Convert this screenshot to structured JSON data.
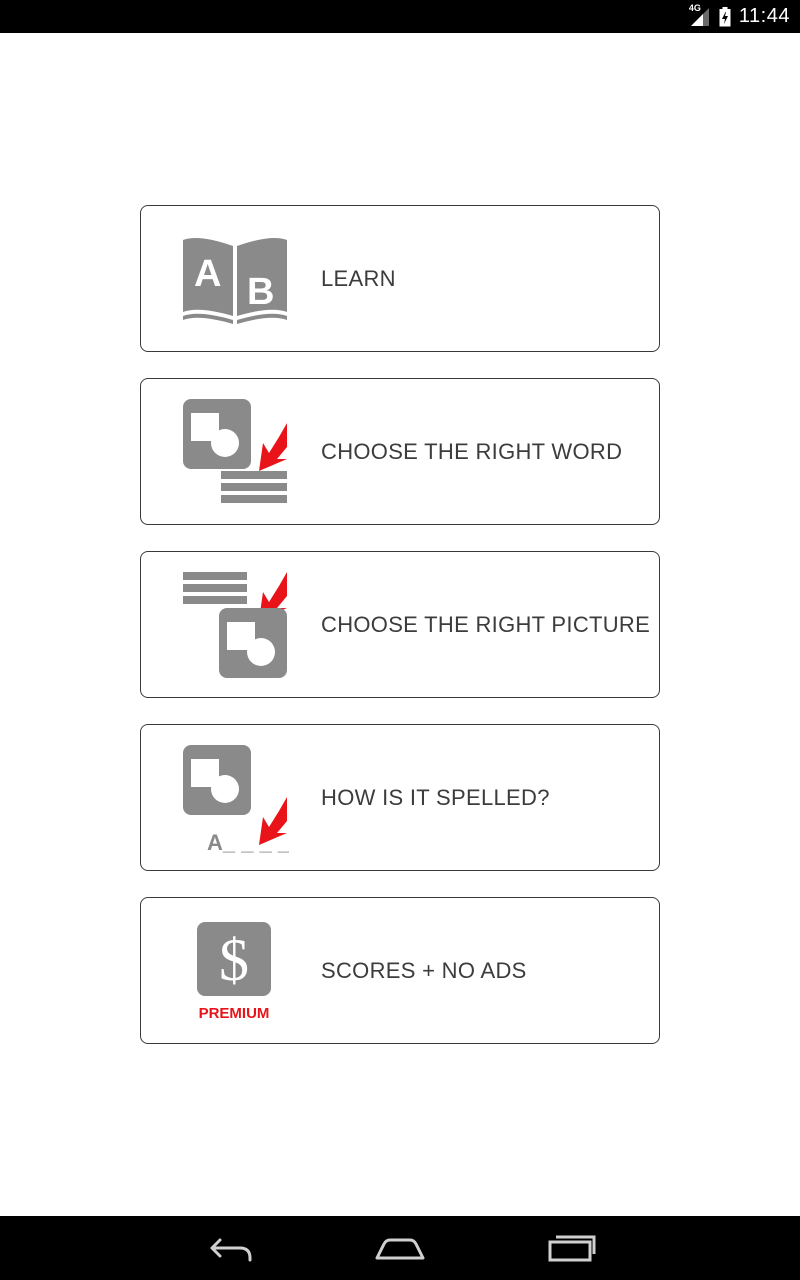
{
  "status_bar": {
    "network_label": "4G",
    "time": "11:44"
  },
  "menu": {
    "items": [
      {
        "label": "LEARN",
        "icon": "book-ab-icon"
      },
      {
        "label": "CHOOSE THE RIGHT WORD",
        "icon": "picture-to-word-icon"
      },
      {
        "label": "CHOOSE THE RIGHT PICTURE",
        "icon": "word-to-picture-icon"
      },
      {
        "label": "HOW IS IT SPELLED?",
        "icon": "spelling-icon",
        "icon_text": "A_ _ _ _ _"
      },
      {
        "label": "SCORES + NO ADS",
        "icon": "premium-dollar-icon",
        "icon_text": "PREMIUM"
      }
    ]
  },
  "nav_bar": {
    "buttons": [
      "back-icon",
      "home-icon",
      "recents-icon"
    ]
  },
  "colors": {
    "icon_gray": "#8a8a8a",
    "accent_red": "#e8141a",
    "text": "#3c3c3c",
    "border": "#3a3a3a"
  }
}
